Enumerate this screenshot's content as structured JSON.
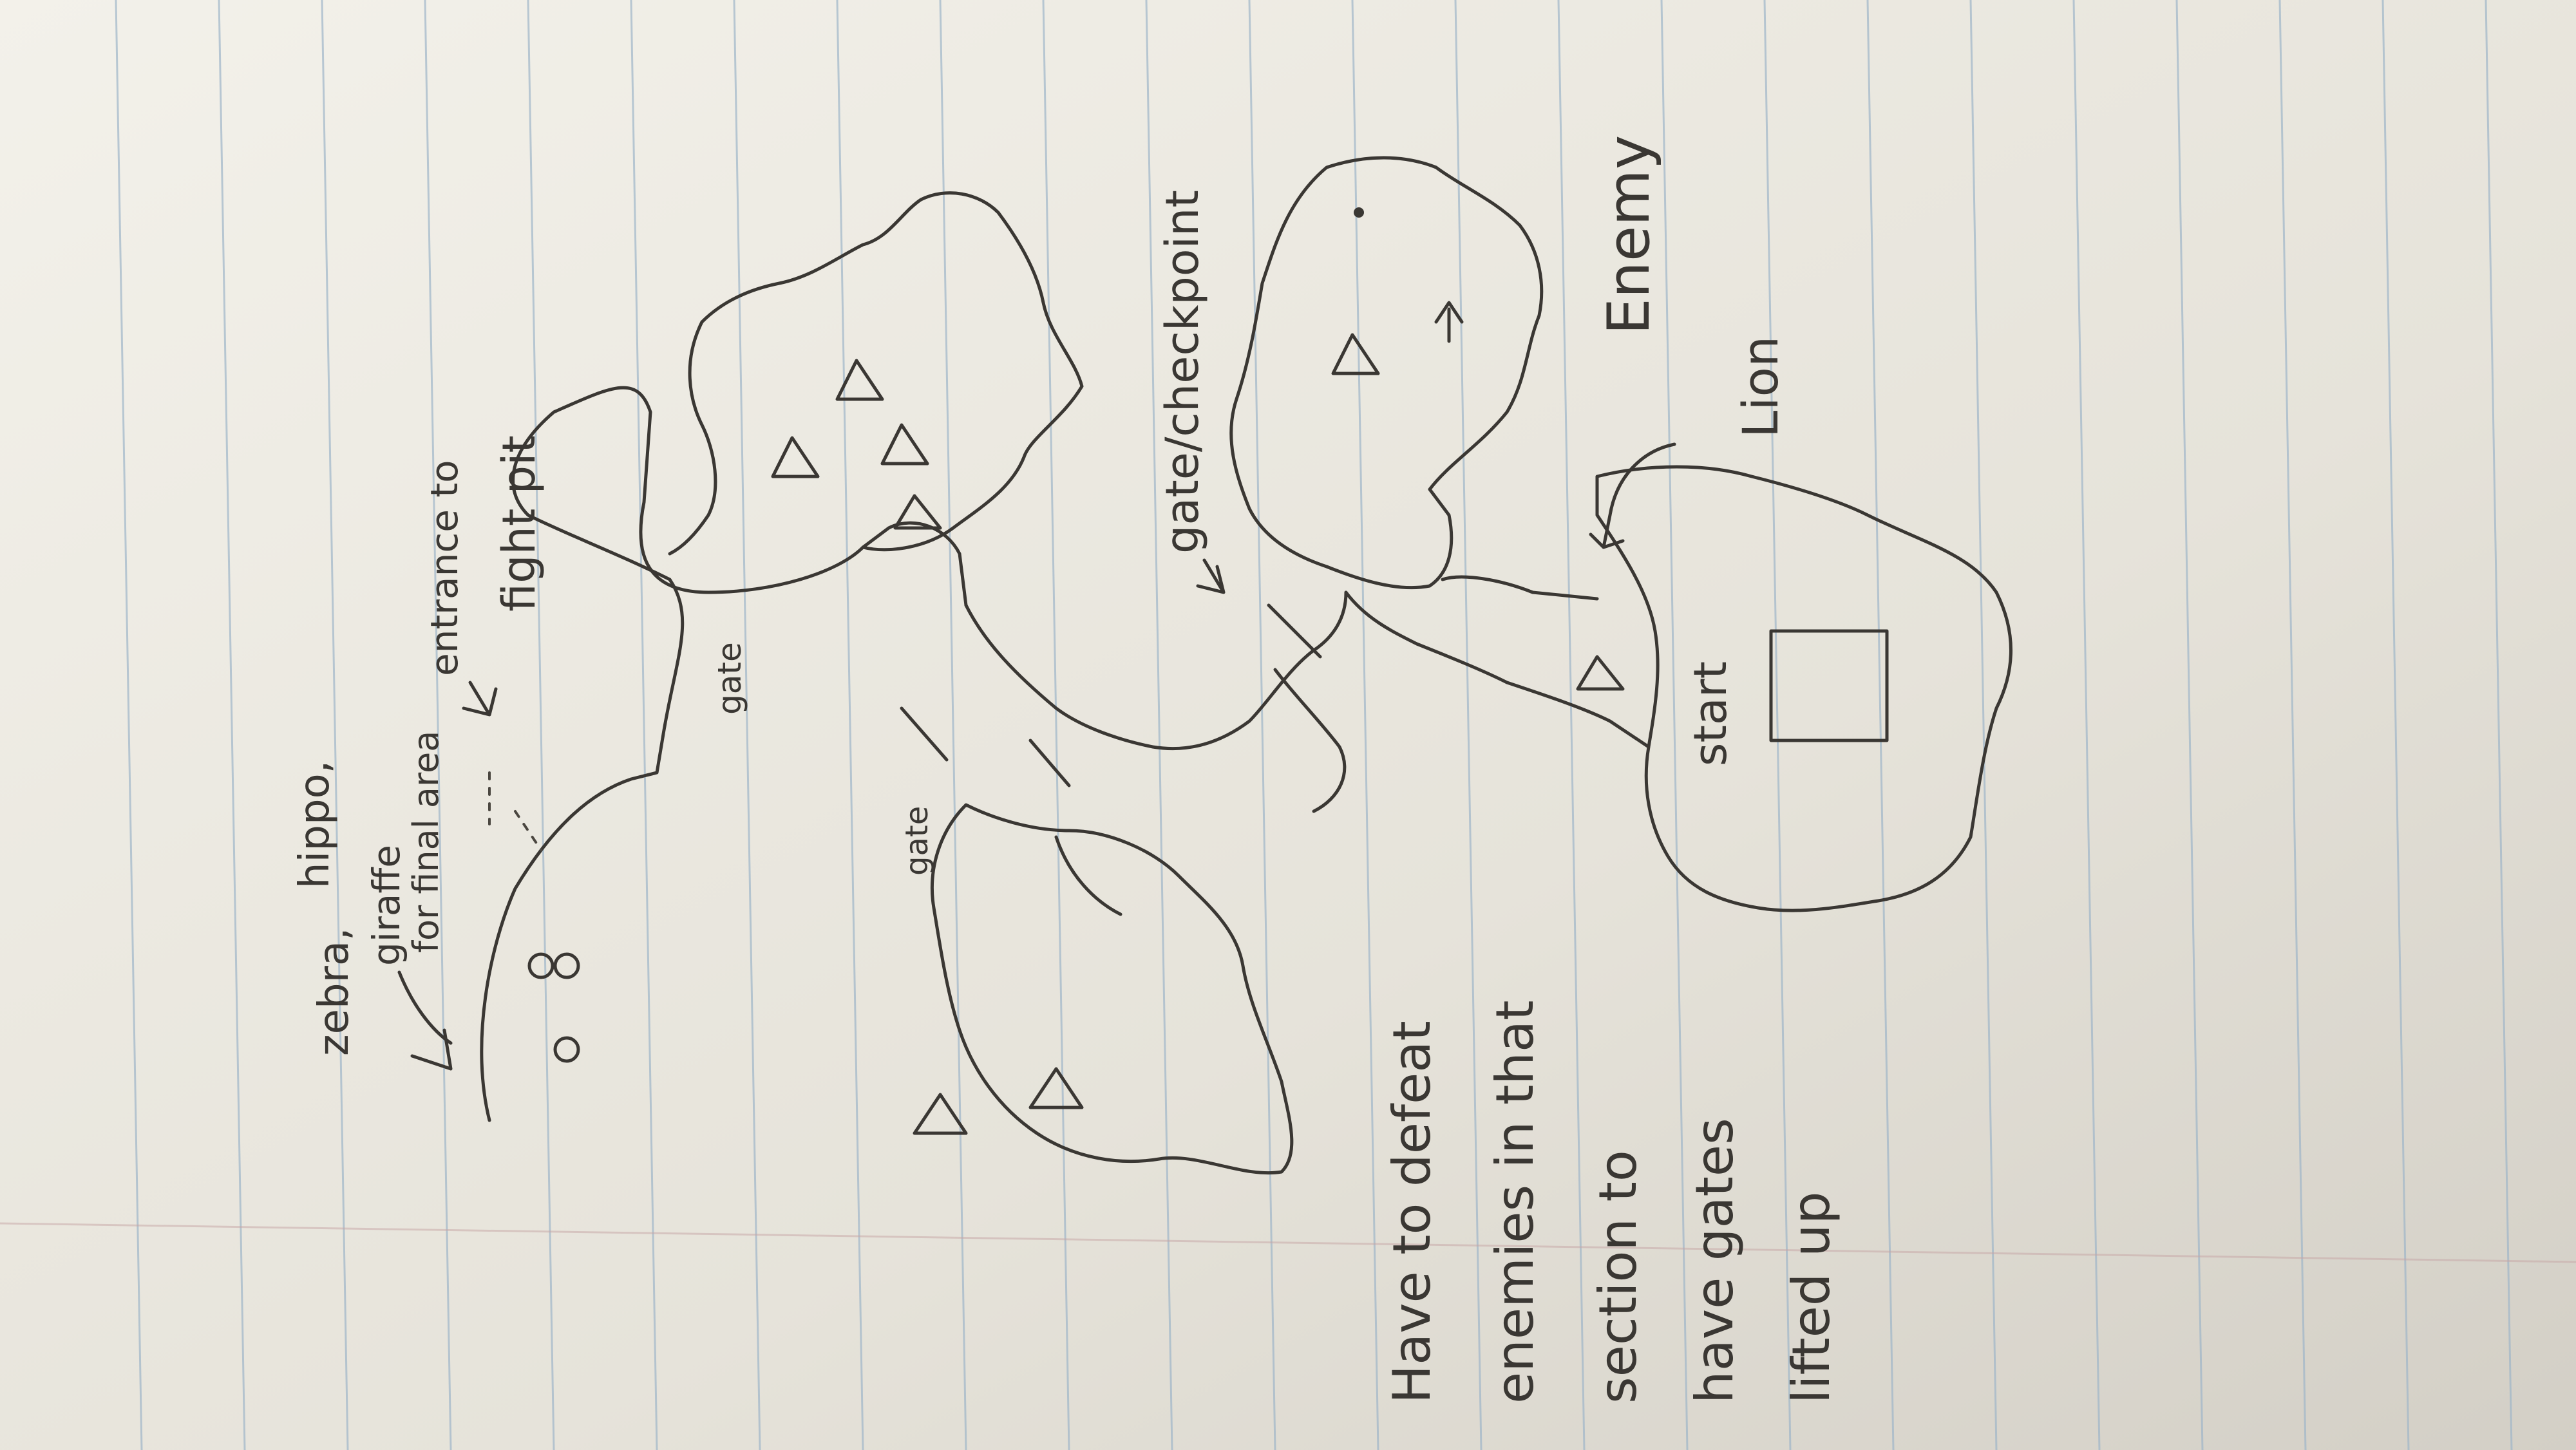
{
  "notes": {
    "animals": [
      "zebra,",
      "hippo,",
      "giraffe",
      "for final area"
    ],
    "entrance": [
      "entrance to",
      "fight pit"
    ],
    "gate_checkpoint": "gate/checkpoint",
    "gate_top": "gate",
    "gate_left": "gate",
    "enemy": "Enemy",
    "lion": "Lion",
    "start": "start",
    "objective": [
      "Have to defeat",
      "enemies in that",
      "section to",
      "have gates",
      "lifted up"
    ]
  },
  "colors": {
    "paper": "#ebe8df",
    "line": "#9fb6c9",
    "margin": "#c7a6a6",
    "ink": "#3a3733"
  }
}
